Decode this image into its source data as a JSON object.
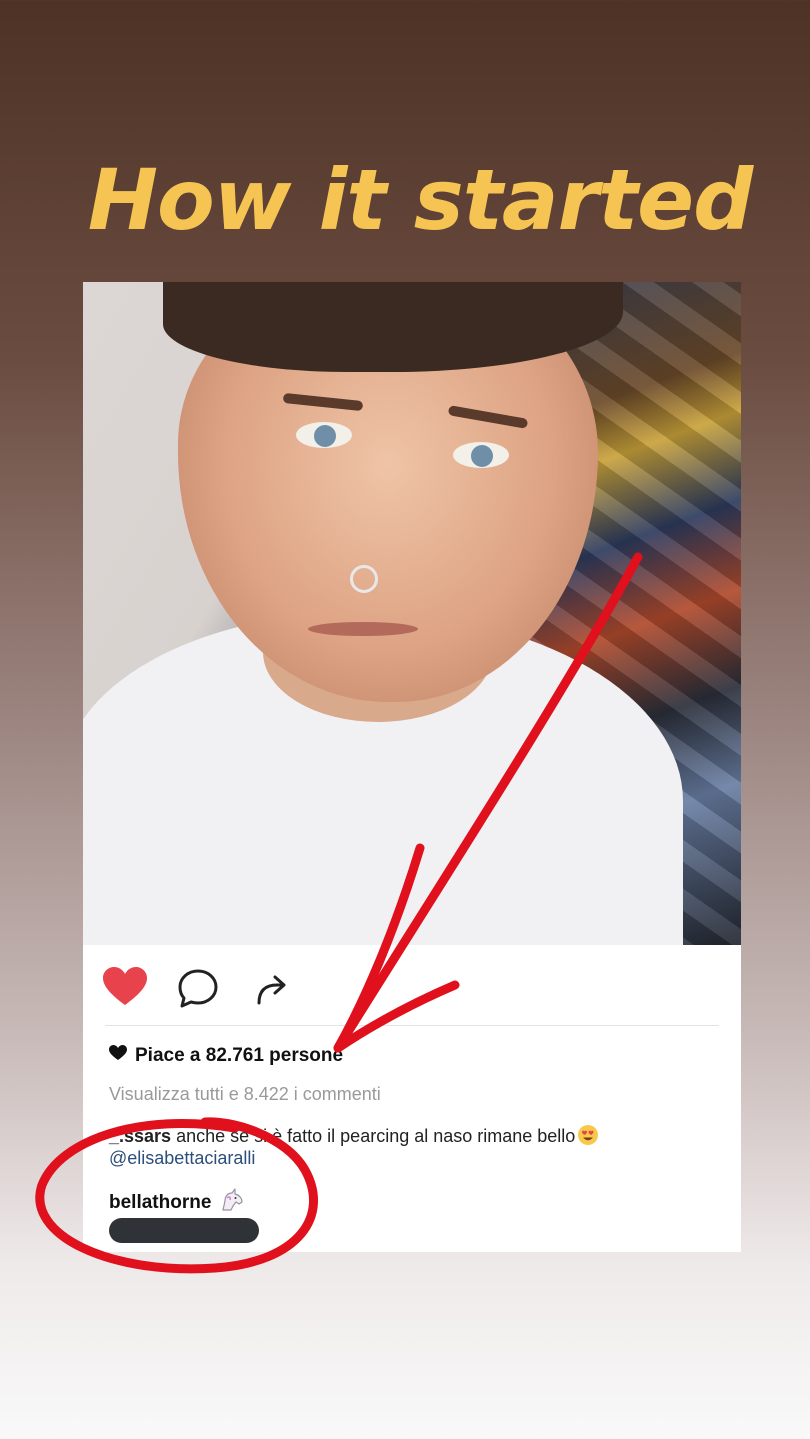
{
  "story": {
    "title": "How it started"
  },
  "post": {
    "likes_text": "Piace a 82.761 persone",
    "view_comments_text": "Visualizza tutti e 8.422 i commenti",
    "comment": {
      "username": "_.ssars",
      "text": "anche se si è fatto il pearcing al naso rimane bello",
      "mention": "@elisabettaciaralli"
    },
    "highlighted_user": "bellathorne",
    "icons": {
      "like": "heart-icon",
      "comment": "comment-icon",
      "share": "share-icon",
      "likes_prefix": "small-heart-icon",
      "comment_emoji": "heart-eyes-emoji-icon",
      "user_emoji": "unicorn-icon"
    }
  },
  "colors": {
    "title": "#f6c453",
    "like_heart": "#e8434c",
    "annotation": "#e0101c",
    "mention": "#2c4e7a"
  }
}
